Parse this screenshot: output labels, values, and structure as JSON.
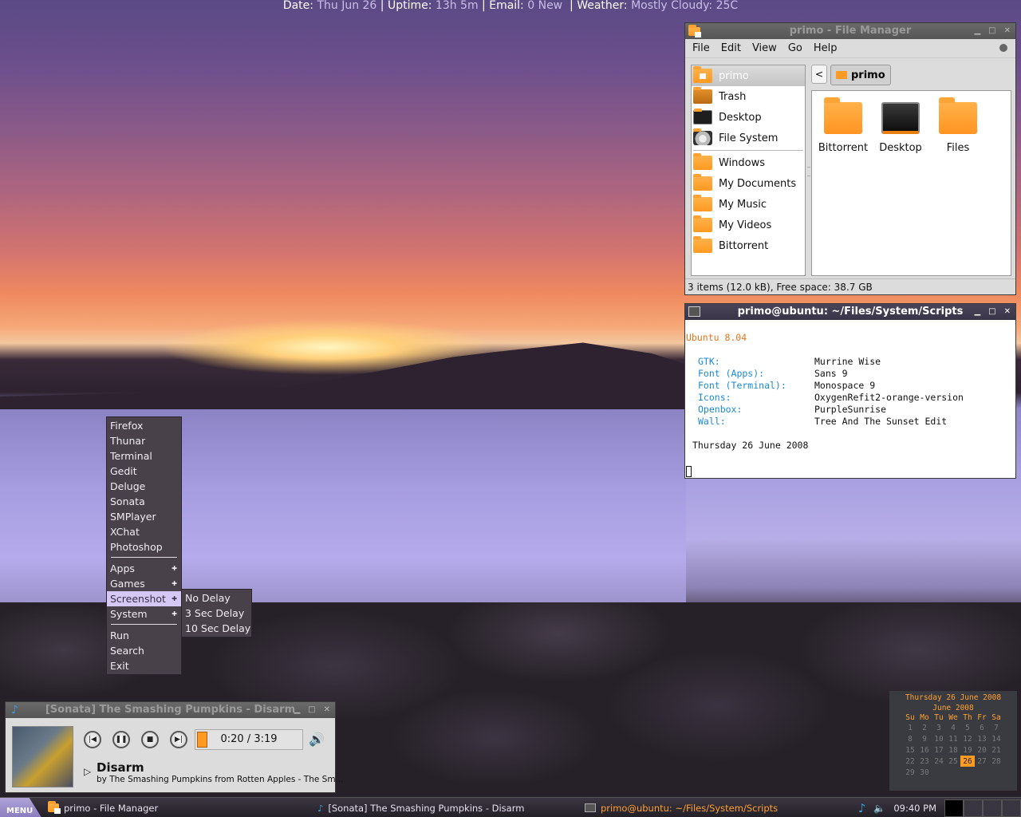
{
  "topbar": {
    "date_label": "Date:",
    "date": "Thu Jun 26",
    "uptime_label": "Uptime:",
    "uptime": "13h 5m",
    "email_label": "Email:",
    "email": "0 New",
    "weather_label": "Weather:",
    "weather": "Mostly Cloudy: 25C"
  },
  "file_manager": {
    "title": "primo - File Manager",
    "menu": [
      "File",
      "Edit",
      "View",
      "Go",
      "Help"
    ],
    "sidebar": [
      {
        "label": "primo",
        "icon": "home-folder-icon",
        "selected": true
      },
      {
        "label": "Trash",
        "icon": "trash-icon"
      },
      {
        "label": "Desktop",
        "icon": "desktop-icon"
      },
      {
        "label": "File System",
        "icon": "harddisk-icon"
      },
      {
        "label": "Windows",
        "icon": "folder-icon"
      },
      {
        "label": "My Documents",
        "icon": "folder-icon"
      },
      {
        "label": "My Music",
        "icon": "folder-icon"
      },
      {
        "label": "My Videos",
        "icon": "folder-icon"
      },
      {
        "label": "Bittorrent",
        "icon": "folder-icon"
      }
    ],
    "back_label": "<",
    "path": "primo",
    "items": [
      {
        "label": "Bittorrent",
        "icon": "folder-icon"
      },
      {
        "label": "Desktop",
        "icon": "desktop-icon"
      },
      {
        "label": "Files",
        "icon": "folder-icon"
      }
    ],
    "status": "3 items (12.0 kB), Free space: 38.7 GB"
  },
  "terminal": {
    "title": "primo@ubuntu: ~/Files/System/Scripts",
    "os": "Ubuntu 8.04",
    "rows": [
      {
        "key": "GTK:",
        "value": "Murrine Wise"
      },
      {
        "key": "Font (Apps):",
        "value": "Sans 9"
      },
      {
        "key": "Font (Terminal):",
        "value": "Monospace 9"
      },
      {
        "key": "Icons:",
        "value": "OxygenRefit2-orange-version"
      },
      {
        "key": "Openbox:",
        "value": "PurpleSunrise"
      },
      {
        "key": "Wall:",
        "value": "Tree And The Sunset Edit"
      }
    ],
    "date_line": "Thursday 26 June 2008"
  },
  "menu": {
    "apps": [
      "Firefox",
      "Thunar",
      "Terminal",
      "Gedit",
      "Deluge",
      "Sonata",
      "SMPlayer",
      "XChat",
      "Photoshop"
    ],
    "submenus": [
      "Apps",
      "Games",
      "Screenshot",
      "System"
    ],
    "highlighted": "Screenshot",
    "actions": [
      "Run",
      "Search",
      "Exit"
    ],
    "screenshot_submenu": [
      "No Delay",
      "3 Sec Delay",
      "10 Sec Delay"
    ]
  },
  "sonata": {
    "title": "[Sonata] The Smashing Pumpkins - Disarm",
    "time": "0:20 / 3:19",
    "progress_fraction": 0.1,
    "song": "Disarm",
    "subtitle": "by The Smashing Pumpkins from Rotten Apples - The Sm..."
  },
  "calendar": {
    "full_date": "Thursday 26 June 2008",
    "month": "June 2008",
    "weekdays": [
      "Su",
      "Mo",
      "Tu",
      "We",
      "Th",
      "Fr",
      "Sa"
    ],
    "weeks": [
      [
        "1",
        "2",
        "3",
        "4",
        "5",
        "6",
        "7"
      ],
      [
        "8",
        "9",
        "10",
        "11",
        "12",
        "13",
        "14"
      ],
      [
        "15",
        "16",
        "17",
        "18",
        "19",
        "20",
        "21"
      ],
      [
        "22",
        "23",
        "24",
        "25",
        "26",
        "27",
        "28"
      ],
      [
        "29",
        "30",
        "",
        "",
        "",
        "",
        ""
      ]
    ],
    "today": "26"
  },
  "taskbar": {
    "menu_label": "MENU",
    "tasks": [
      {
        "label": "primo - File Manager"
      },
      {
        "label": "[Sonata] The Smashing Pumpkins - Disarm"
      },
      {
        "label": "primo@ubuntu: ~/Files/System/Scripts",
        "active": true
      }
    ],
    "clock": "09:40 PM"
  }
}
